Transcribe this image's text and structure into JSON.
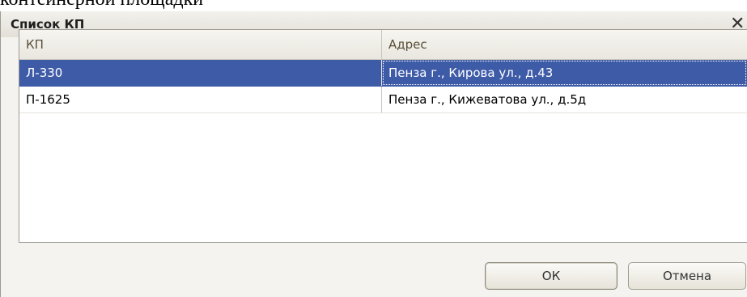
{
  "background": {
    "text": "контейнерной площадки"
  },
  "dialog": {
    "title": "Список КП",
    "close_icon": "close-icon"
  },
  "table": {
    "columns": [
      "КП",
      "Адрес"
    ],
    "rows": [
      {
        "kp": "Л-330",
        "address": "Пенза г., Кирова ул., д.43",
        "selected": true
      },
      {
        "kp": "П-1625",
        "address": "Пенза г., Кижеватова ул., д.5д",
        "selected": false
      }
    ]
  },
  "buttons": {
    "ok": "ОК",
    "cancel": "Отмена"
  },
  "colors": {
    "selection": "#3e5ba8",
    "window_bg": "#f5f3ef"
  }
}
